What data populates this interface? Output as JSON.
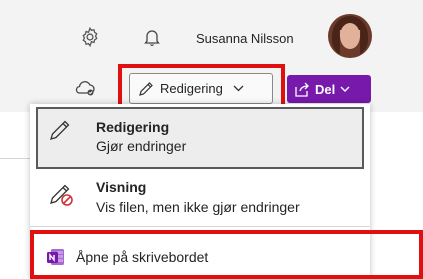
{
  "header": {
    "user_name": "Susanna Nilsson",
    "icons": {
      "settings": "gear-icon",
      "notifications": "bell-icon",
      "avatar": "avatar"
    }
  },
  "toolbar": {
    "edit_mode_label": "Redigering",
    "share_label": "Del",
    "icons": {
      "cloud": "cloud-sync-icon",
      "pencil": "pencil-icon",
      "share": "share-icon"
    }
  },
  "menu": {
    "items": [
      {
        "title": "Redigering",
        "subtitle": "Gjør endringer",
        "icon": "pencil-icon",
        "selected": true
      },
      {
        "title": "Visning",
        "subtitle": "Vis filen, men ikke gjør endringer",
        "icon": "pencil-blocked-icon",
        "selected": false
      }
    ],
    "open_desktop_label": "Åpne på skrivebordet",
    "open_desktop_icon": "onenote-icon"
  },
  "colors": {
    "accent_purple": "#7719aa",
    "highlight_red": "#e01010",
    "onenote_purple": "#7719aa",
    "blocked_red": "#d13438"
  }
}
